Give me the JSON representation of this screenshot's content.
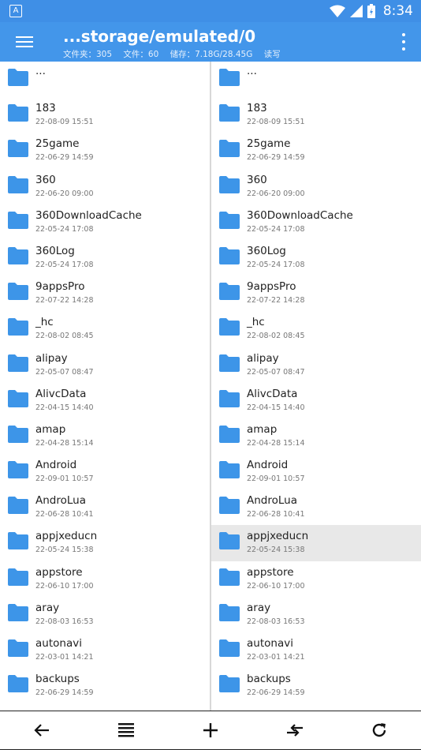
{
  "status": {
    "app_icon": "A",
    "time": "8:34",
    "icons": [
      "wifi-icon",
      "signal-icon",
      "battery-icon"
    ]
  },
  "header": {
    "title": "...storage/emulated/0",
    "folders": "文件夹：305",
    "files": "文件：60",
    "storage": "储存：7.18G/28.45G",
    "mode": "读写"
  },
  "colors": {
    "statusbar": "#3F8FE6",
    "appbar": "#4396EA",
    "folder": "#3D95E8",
    "selected": "#e8e8e8"
  },
  "left": {
    "up": "...",
    "items": [
      {
        "name": "183",
        "date": "22-08-09 15:51"
      },
      {
        "name": "25game",
        "date": "22-06-29 14:59"
      },
      {
        "name": "360",
        "date": "22-06-20 09:00"
      },
      {
        "name": "360DownloadCache",
        "date": "22-05-24 17:08"
      },
      {
        "name": "360Log",
        "date": "22-05-24 17:08"
      },
      {
        "name": "9appsPro",
        "date": "22-07-22 14:28"
      },
      {
        "name": "_hc",
        "date": "22-08-02 08:45"
      },
      {
        "name": "alipay",
        "date": "22-05-07 08:47"
      },
      {
        "name": "AlivcData",
        "date": "22-04-15 14:40"
      },
      {
        "name": "amap",
        "date": "22-04-28 15:14"
      },
      {
        "name": "Android",
        "date": "22-09-01 10:57"
      },
      {
        "name": "AndroLua",
        "date": "22-06-28 10:41"
      },
      {
        "name": "appjxeducn",
        "date": "22-05-24 15:38"
      },
      {
        "name": "appstore",
        "date": "22-06-10 17:00"
      },
      {
        "name": "aray",
        "date": "22-08-03 16:53"
      },
      {
        "name": "autonavi",
        "date": "22-03-01 14:21"
      },
      {
        "name": "backups",
        "date": "22-06-29 14:59"
      }
    ]
  },
  "right": {
    "up": "...",
    "selected_index": 12,
    "items": [
      {
        "name": "183",
        "date": "22-08-09 15:51"
      },
      {
        "name": "25game",
        "date": "22-06-29 14:59"
      },
      {
        "name": "360",
        "date": "22-06-20 09:00"
      },
      {
        "name": "360DownloadCache",
        "date": "22-05-24 17:08"
      },
      {
        "name": "360Log",
        "date": "22-05-24 17:08"
      },
      {
        "name": "9appsPro",
        "date": "22-07-22 14:28"
      },
      {
        "name": "_hc",
        "date": "22-08-02 08:45"
      },
      {
        "name": "alipay",
        "date": "22-05-07 08:47"
      },
      {
        "name": "AlivcData",
        "date": "22-04-15 14:40"
      },
      {
        "name": "amap",
        "date": "22-04-28 15:14"
      },
      {
        "name": "Android",
        "date": "22-09-01 10:57"
      },
      {
        "name": "AndroLua",
        "date": "22-06-28 10:41"
      },
      {
        "name": "appjxeducn",
        "date": "22-05-24 15:38"
      },
      {
        "name": "appstore",
        "date": "22-06-10 17:00"
      },
      {
        "name": "aray",
        "date": "22-08-03 16:53"
      },
      {
        "name": "autonavi",
        "date": "22-03-01 14:21"
      },
      {
        "name": "backups",
        "date": "22-06-29 14:59"
      }
    ]
  },
  "bottombar": [
    "back-arrow-icon",
    "list-view-icon",
    "add-icon",
    "swap-panes-icon",
    "refresh-icon"
  ]
}
